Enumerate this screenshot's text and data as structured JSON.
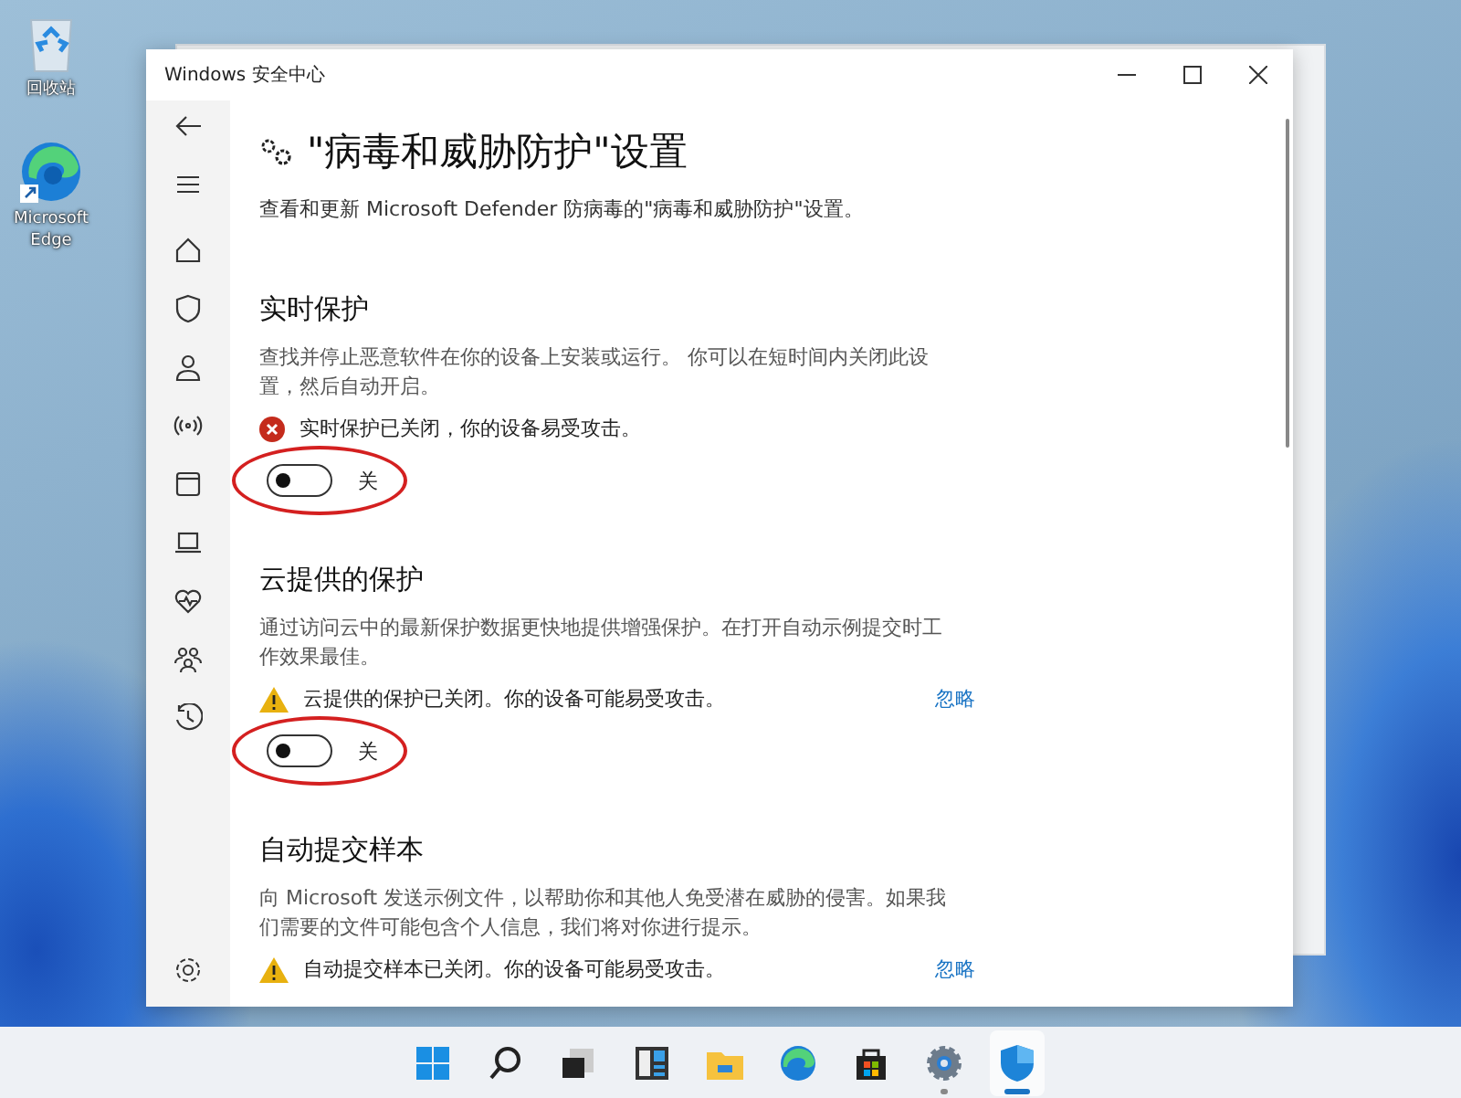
{
  "desktop_icons": [
    {
      "kind": "recycle-bin",
      "label": "回收站"
    },
    {
      "kind": "edge",
      "label": "Microsoft Edge"
    }
  ],
  "window": {
    "title": "Windows 安全中心"
  },
  "page": {
    "heading": "\"病毒和威胁防护\"设置",
    "subtitle": "查看和更新 Microsoft Defender 防病毒的\"病毒和威胁防护\"设置。"
  },
  "sections": [
    {
      "title": "实时保护",
      "description": "查找并停止恶意软件在你的设备上安装或运行。 你可以在短时间内关闭此设置，然后自动开启。",
      "status": {
        "kind": "error",
        "text": "实时保护已关闭，你的设备易受攻击。"
      },
      "toggle": {
        "on": false,
        "label": "关",
        "circled": true
      }
    },
    {
      "title": "云提供的保护",
      "description": "通过访问云中的最新保护数据更快地提供增强保护。在打开自动示例提交时工作效果最佳。",
      "status": {
        "kind": "warning",
        "text": "云提供的保护已关闭。你的设备可能易受攻击。",
        "action": "忽略"
      },
      "toggle": {
        "on": false,
        "label": "关",
        "circled": true
      }
    },
    {
      "title": "自动提交样本",
      "description": "向 Microsoft 发送示例文件，以帮助你和其他人免受潜在威胁的侵害。如果我们需要的文件可能包含个人信息，我们将对你进行提示。",
      "status": {
        "kind": "warning",
        "text": "自动提交样本已关闭。你的设备可能易受攻击。",
        "action": "忽略"
      }
    }
  ],
  "taskbar": [
    {
      "kind": "start",
      "running": false,
      "active": false
    },
    {
      "kind": "search",
      "running": false,
      "active": false
    },
    {
      "kind": "task-view",
      "running": false,
      "active": false
    },
    {
      "kind": "widgets",
      "running": false,
      "active": false
    },
    {
      "kind": "explorer",
      "running": false,
      "active": false
    },
    {
      "kind": "edge",
      "running": false,
      "active": false
    },
    {
      "kind": "store",
      "running": false,
      "active": false
    },
    {
      "kind": "settings",
      "running": true,
      "active": false
    },
    {
      "kind": "security",
      "running": true,
      "active": true
    }
  ]
}
